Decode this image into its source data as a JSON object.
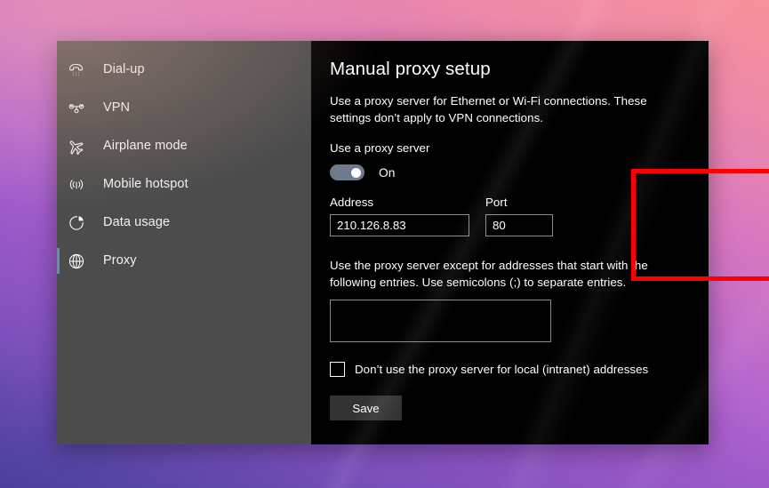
{
  "desktop": {
    "wallpaper_top_color": "#f79099",
    "wallpaper_mid_color": "#b566cf",
    "wallpaper_bottom_color": "#4b3f9e"
  },
  "window": {
    "sidebar_bg": "#4c4c4c",
    "main_bg": "#000000",
    "selection_accent": "#6f8aa5"
  },
  "sidebar": {
    "items": [
      {
        "label": "Dial-up",
        "icon": "telephone-icon",
        "selected": false
      },
      {
        "label": "VPN",
        "icon": "vpn-icon",
        "selected": false
      },
      {
        "label": "Airplane mode",
        "icon": "airplane-icon",
        "selected": false
      },
      {
        "label": "Mobile hotspot",
        "icon": "hotspot-signal-icon",
        "selected": false
      },
      {
        "label": "Data usage",
        "icon": "pie-chart-icon",
        "selected": false
      },
      {
        "label": "Proxy",
        "icon": "globe-icon",
        "selected": true
      }
    ]
  },
  "main": {
    "title": "Manual proxy setup",
    "intro_text": "Use a proxy server for Ethernet or Wi-Fi connections. These settings don’t apply to VPN connections.",
    "proxy_group": {
      "label": "Use a proxy server",
      "toggle_state": "On",
      "toggle_on": true,
      "highlight_color": "#fe0000",
      "address": {
        "label": "Address",
        "value": "210.126.8.83",
        "placeholder": ""
      },
      "port": {
        "label": "Port",
        "value": "80",
        "placeholder": ""
      }
    },
    "exceptions": {
      "description": "Use the proxy server except for addresses that start with the following entries. Use semicolons (;) to separate entries.",
      "value": "",
      "placeholder": ""
    },
    "local_bypass": {
      "label": "Don’t use the proxy server for local (intranet) addresses",
      "checked": false
    },
    "save_label": "Save"
  }
}
